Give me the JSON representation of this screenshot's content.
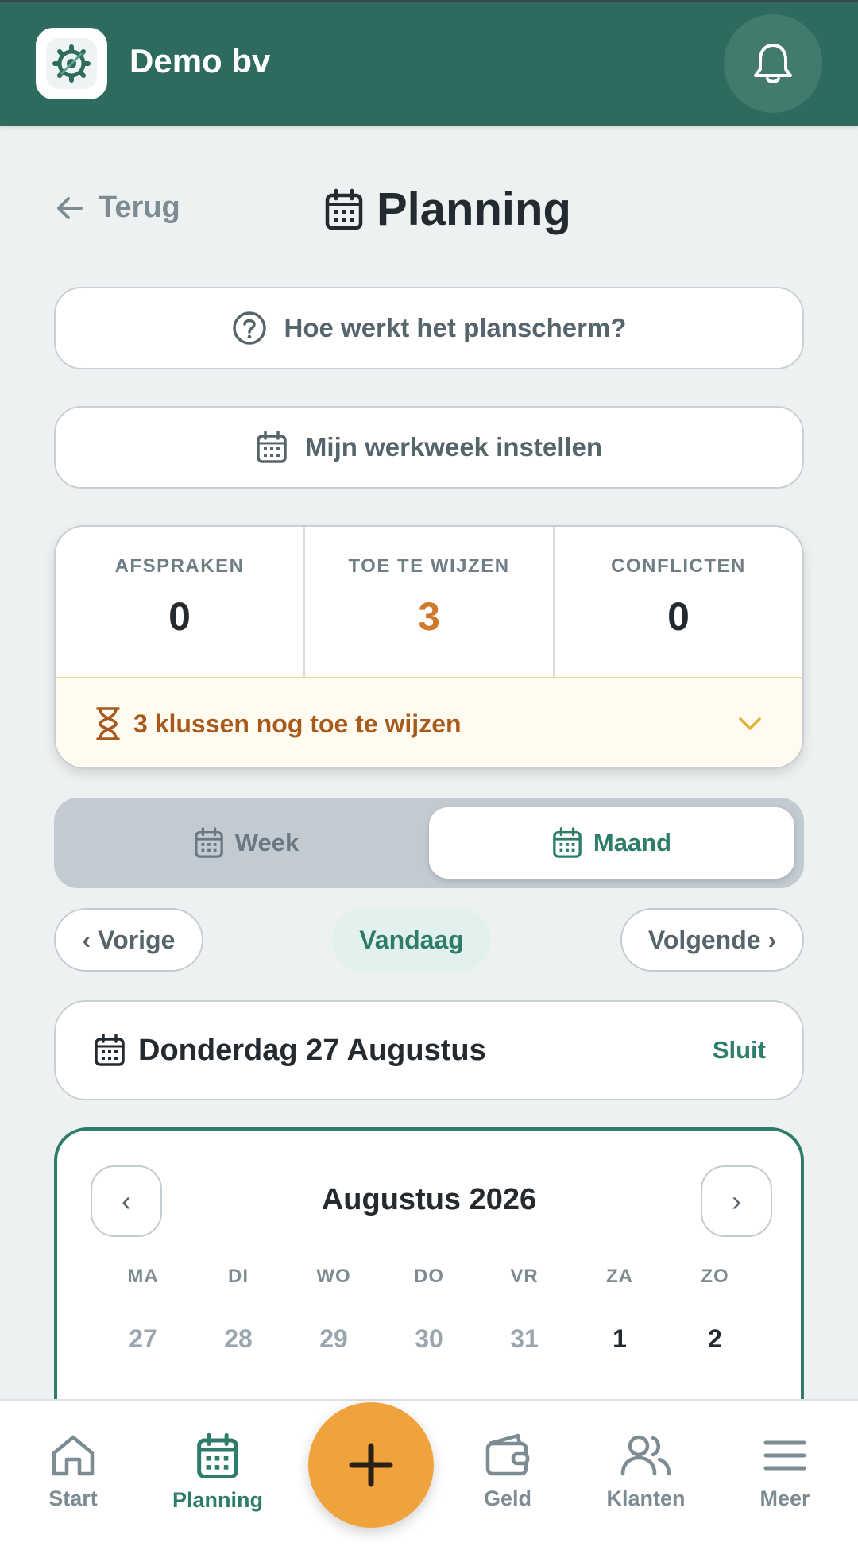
{
  "header": {
    "company_name": "Demo bv",
    "logo_icon": "gear-logo-icon",
    "notification_icon": "bell-icon"
  },
  "page": {
    "back_label": "Terug",
    "title": "Planning"
  },
  "actions": {
    "help_label": "Hoe werkt het planscherm?",
    "workweek_label": "Mijn werkweek instellen"
  },
  "stats": {
    "items": [
      {
        "label": "AFSPRAKEN",
        "value": "0"
      },
      {
        "label": "TOE TE WIJZEN",
        "value": "3"
      },
      {
        "label": "CONFLICTEN",
        "value": "0"
      }
    ],
    "pending_text": "3 klussen nog toe te wijzen"
  },
  "view_toggle": {
    "week_label": "Week",
    "month_label": "Maand",
    "active": "Maand"
  },
  "navigation": {
    "prev_label": "‹ Vorige",
    "today_label": "Vandaag",
    "next_label": "Volgende ›"
  },
  "selected_date": {
    "label": "Donderdag 27 Augustus",
    "close_label": "Sluit"
  },
  "calendar": {
    "prev_arrow": "‹",
    "next_arrow": "›",
    "month_title": "Augustus 2026",
    "weekdays": [
      "MA",
      "DI",
      "WO",
      "DO",
      "VR",
      "ZA",
      "ZO"
    ],
    "first_row": [
      "27",
      "28",
      "29",
      "30",
      "31",
      "1",
      "2"
    ]
  },
  "bottom_nav": {
    "items": [
      {
        "label": "Start",
        "icon": "home-icon"
      },
      {
        "label": "Planning",
        "icon": "calendar-icon"
      },
      {
        "label": "Geld",
        "icon": "wallet-icon"
      },
      {
        "label": "Klanten",
        "icon": "users-icon"
      },
      {
        "label": "Meer",
        "icon": "menu-icon"
      }
    ],
    "active": "Planning",
    "fab_icon": "plus-icon"
  },
  "colors": {
    "brand": "#2e6b5e",
    "accent": "#2e7d6b",
    "warning": "#cf7a2b",
    "fab": "#f0a33c"
  }
}
